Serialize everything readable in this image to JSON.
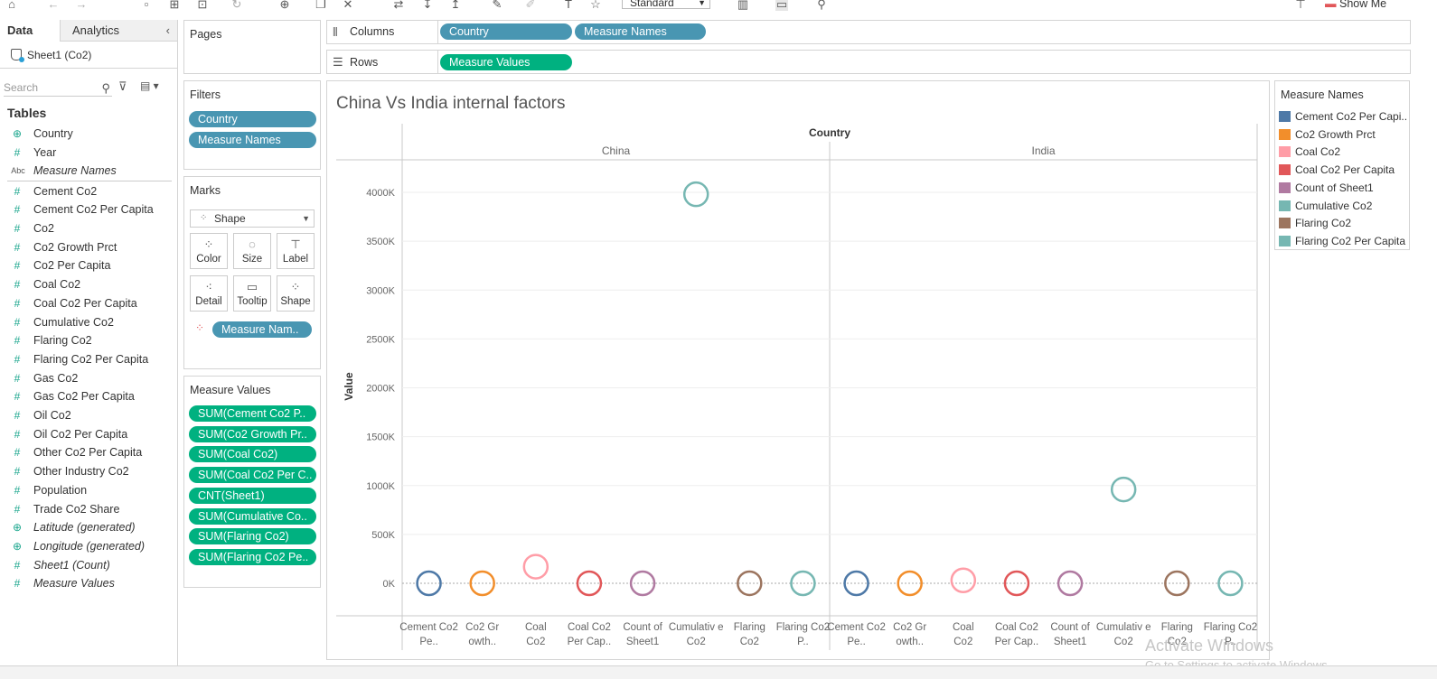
{
  "toolbar": {
    "view_select": "Standard",
    "show_me": "Show Me"
  },
  "datapane": {
    "tab_data": "Data",
    "tab_analytics": "Analytics",
    "datasource": "Sheet1 (Co2)",
    "search_placeholder": "Search",
    "tables_heading": "Tables",
    "dimensions": [
      {
        "label": "Country",
        "icon": "globe-icon"
      },
      {
        "label": "Year",
        "icon": "hash-icon"
      },
      {
        "label": "Measure Names",
        "icon": "abc-icon"
      }
    ],
    "measures": [
      "Cement Co2",
      "Cement Co2 Per Capita",
      "Co2",
      "Co2 Growth Prct",
      "Co2 Per Capita",
      "Coal Co2",
      "Coal Co2 Per Capita",
      "Cumulative Co2",
      "Flaring Co2",
      "Flaring Co2 Per Capita",
      "Gas Co2",
      "Gas Co2 Per Capita",
      "Oil Co2",
      "Oil Co2 Per Capita",
      "Other Co2 Per Capita",
      "Other Industry Co2",
      "Population",
      "Trade Co2 Share"
    ],
    "generated": [
      {
        "label": "Latitude (generated)",
        "icon": "globe-icon"
      },
      {
        "label": "Longitude (generated)",
        "icon": "globe-icon"
      },
      {
        "label": "Sheet1 (Count)",
        "icon": "hash-icon"
      },
      {
        "label": "Measure Values",
        "icon": "hash-icon"
      }
    ]
  },
  "pages": {
    "title": "Pages"
  },
  "filters": {
    "title": "Filters",
    "pills": [
      "Country",
      "Measure Names"
    ]
  },
  "marks": {
    "title": "Marks",
    "mark_type": "Shape",
    "buttons": [
      "Color",
      "Size",
      "Label",
      "Detail",
      "Tooltip",
      "Shape"
    ],
    "color_pill": "Measure Nam.."
  },
  "measure_values": {
    "title": "Measure Values",
    "pills": [
      "SUM(Cement Co2 P..",
      "SUM(Co2 Growth Pr..",
      "SUM(Coal Co2)",
      "SUM(Coal Co2 Per C..",
      "CNT(Sheet1)",
      "SUM(Cumulative Co..",
      "SUM(Flaring Co2)",
      "SUM(Flaring Co2 Pe.."
    ]
  },
  "shelves": {
    "columns_label": "Columns",
    "columns_pills": [
      "Country",
      "Measure Names"
    ],
    "rows_label": "Rows",
    "rows_pills": [
      "Measure Values"
    ]
  },
  "legend": {
    "title": "Measure Names",
    "items": [
      {
        "label": "Cement Co2 Per Capi..",
        "color": "#4e79a7"
      },
      {
        "label": "Co2 Growth Prct",
        "color": "#f28e2b"
      },
      {
        "label": "Coal Co2",
        "color": "#ff9da7"
      },
      {
        "label": "Coal Co2 Per Capita",
        "color": "#e15759"
      },
      {
        "label": "Count of Sheet1",
        "color": "#b07aa1"
      },
      {
        "label": "Cumulative Co2",
        "color": "#76b7b2"
      },
      {
        "label": "Flaring Co2",
        "color": "#9c755f"
      },
      {
        "label": "Flaring Co2 Per Capita",
        "color": "#76b7b2"
      }
    ]
  },
  "chart_data": {
    "type": "scatter",
    "title": "China Vs India internal factors",
    "column_header": "Country",
    "ylabel": "Value",
    "ylim": [
      -300000,
      4250000
    ],
    "yticks": [
      0,
      500000,
      1000000,
      1500000,
      2000000,
      2500000,
      3000000,
      3500000,
      4000000
    ],
    "ytick_labels": [
      "0K",
      "500K",
      "1000K",
      "1500K",
      "2000K",
      "2500K",
      "3000K",
      "3500K",
      "4000K"
    ],
    "grid": true,
    "panels": [
      {
        "name": "China",
        "categories": [
          "Cement Co2 Pe..",
          "Co2 Gr owth..",
          "Coal Co2",
          "Coal Co2 Per Cap..",
          "Count of Sheet1",
          "Cumulativ e Co2",
          "Flaring Co2",
          "Flaring Co2 P.."
        ],
        "values": [
          10,
          100,
          170000,
          60,
          30,
          3980000,
          150,
          1
        ],
        "colors": [
          "#4e79a7",
          "#f28e2b",
          "#ff9da7",
          "#e15759",
          "#b07aa1",
          "#76b7b2",
          "#9c755f",
          "#76b7b2"
        ]
      },
      {
        "name": "India",
        "categories": [
          "Cement Co2 Pe..",
          "Co2 Gr owth..",
          "Coal Co2",
          "Coal Co2 Per Cap..",
          "Count of Sheet1",
          "Cumulativ e Co2",
          "Flaring Co2",
          "Flaring Co2 P.."
        ],
        "values": [
          5,
          100,
          30000,
          40,
          30,
          960000,
          50,
          1
        ],
        "colors": [
          "#4e79a7",
          "#f28e2b",
          "#ff9da7",
          "#e15759",
          "#b07aa1",
          "#76b7b2",
          "#9c755f",
          "#76b7b2"
        ]
      }
    ]
  },
  "watermark": {
    "line1": "Activate Windows",
    "line2": "Go to Settings to activate Windows."
  }
}
